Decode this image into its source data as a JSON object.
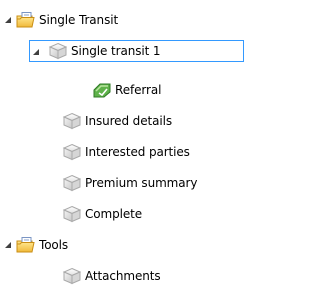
{
  "tree": {
    "single_transit": {
      "label": "Single Transit",
      "icon": "folder-document-icon",
      "expanded": true
    },
    "single_transit_1": {
      "label": "Single transit 1",
      "icon": "cube-icon",
      "expanded": true,
      "selected": true
    },
    "referral": {
      "label": "Referral",
      "icon": "referral-green-icon"
    },
    "insured_details": {
      "label": "Insured details",
      "icon": "cube-icon"
    },
    "interested_parties": {
      "label": "Interested parties",
      "icon": "cube-icon"
    },
    "premium_summary": {
      "label": "Premium summary",
      "icon": "cube-icon"
    },
    "complete": {
      "label": "Complete",
      "icon": "cube-icon"
    },
    "tools": {
      "label": "Tools",
      "icon": "folder-document-icon",
      "expanded": true
    },
    "attachments": {
      "label": "Attachments",
      "icon": "cube-icon"
    }
  },
  "colors": {
    "selection_border": "#3399ff",
    "toggle_arrow": "#404040",
    "text": "#000000"
  }
}
